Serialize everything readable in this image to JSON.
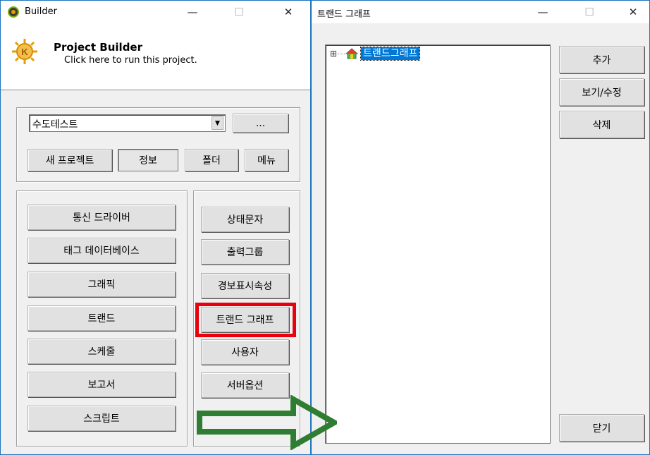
{
  "builder": {
    "title": "Builder",
    "header_title": "Project Builder",
    "header_subtitle": "Click here to run this project.",
    "project_select": {
      "value": "수도테스트"
    },
    "browse_label": "...",
    "top_buttons": [
      "새 프로젝트",
      "정보",
      "폴더",
      "메뉴"
    ],
    "left_buttons": [
      "통신 드라이버",
      "태그 데이터베이스",
      "그래픽",
      "트랜드",
      "스케줄",
      "보고서",
      "스크립트"
    ],
    "right_buttons": [
      "상태문자",
      "출력그룹",
      "경보표시속성",
      "트랜드 그래프",
      "사용자",
      "서버옵션"
    ],
    "window_controls": {
      "minimize": "—",
      "maximize": "☐",
      "close": "✕"
    }
  },
  "trend_window": {
    "title": "트랜드 그래프",
    "tree": [
      {
        "label": "트랜드그래프",
        "expander": "⊞",
        "icon": "house-icon"
      }
    ],
    "buttons": [
      "추가",
      "보기/수정",
      "삭제"
    ],
    "close_button": "닫기",
    "window_controls": {
      "minimize": "—",
      "maximize": "☐",
      "close": "✕"
    }
  },
  "colors": {
    "highlight_box": "#e8000d",
    "arrow_outline": "#2e7d32",
    "selection": "#0078d7",
    "window_border": "#1e73be"
  }
}
